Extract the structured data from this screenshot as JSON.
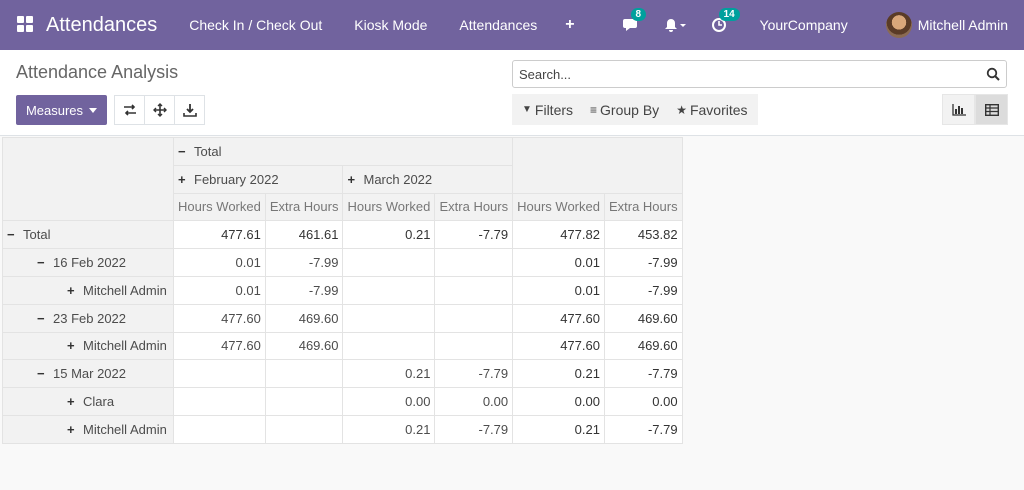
{
  "navbar": {
    "app_title": "Attendances",
    "menu": [
      "Check In / Check Out",
      "Kiosk Mode",
      "Attendances"
    ],
    "plus_label": "+",
    "messages_badge": "8",
    "activity_badge": "14",
    "company": "YourCompany",
    "user": "Mitchell Admin"
  },
  "control_panel": {
    "title": "Attendance Analysis",
    "search_placeholder": "Search...",
    "measures_label": "Measures",
    "filters_label": "Filters",
    "groupby_label": "Group By",
    "favorites_label": "Favorites"
  },
  "pivot": {
    "col_total": "Total",
    "col_groups": [
      "February 2022",
      "March 2022"
    ],
    "measures": [
      "Hours Worked",
      "Extra Hours"
    ],
    "rows": [
      {
        "label": "Total",
        "sign": "−",
        "level": 0,
        "bold": true,
        "vals": [
          "477.61",
          "461.61",
          "0.21",
          "-7.79",
          "477.82",
          "453.82"
        ]
      },
      {
        "label": "16 Feb 2022",
        "sign": "−",
        "level": 1,
        "bold": false,
        "vals": [
          "0.01",
          "-7.99",
          "",
          "",
          "0.01",
          "-7.99"
        ]
      },
      {
        "label": "Mitchell Admin",
        "sign": "+",
        "level": 2,
        "bold": false,
        "vals": [
          "0.01",
          "-7.99",
          "",
          "",
          "0.01",
          "-7.99"
        ]
      },
      {
        "label": "23 Feb 2022",
        "sign": "−",
        "level": 1,
        "bold": false,
        "vals": [
          "477.60",
          "469.60",
          "",
          "",
          "477.60",
          "469.60"
        ]
      },
      {
        "label": "Mitchell Admin",
        "sign": "+",
        "level": 2,
        "bold": false,
        "vals": [
          "477.60",
          "469.60",
          "",
          "",
          "477.60",
          "469.60"
        ]
      },
      {
        "label": "15 Mar 2022",
        "sign": "−",
        "level": 1,
        "bold": false,
        "vals": [
          "",
          "",
          "0.21",
          "-7.79",
          "0.21",
          "-7.79"
        ]
      },
      {
        "label": "Clara",
        "sign": "+",
        "level": 2,
        "bold": false,
        "vals": [
          "",
          "",
          "0.00",
          "0.00",
          "0.00",
          "0.00"
        ]
      },
      {
        "label": "Mitchell Admin",
        "sign": "+",
        "level": 2,
        "bold": false,
        "vals": [
          "",
          "",
          "0.21",
          "-7.79",
          "0.21",
          "-7.79"
        ]
      }
    ]
  },
  "colors": {
    "brand": "#71639e",
    "badge": "#00a09d"
  }
}
